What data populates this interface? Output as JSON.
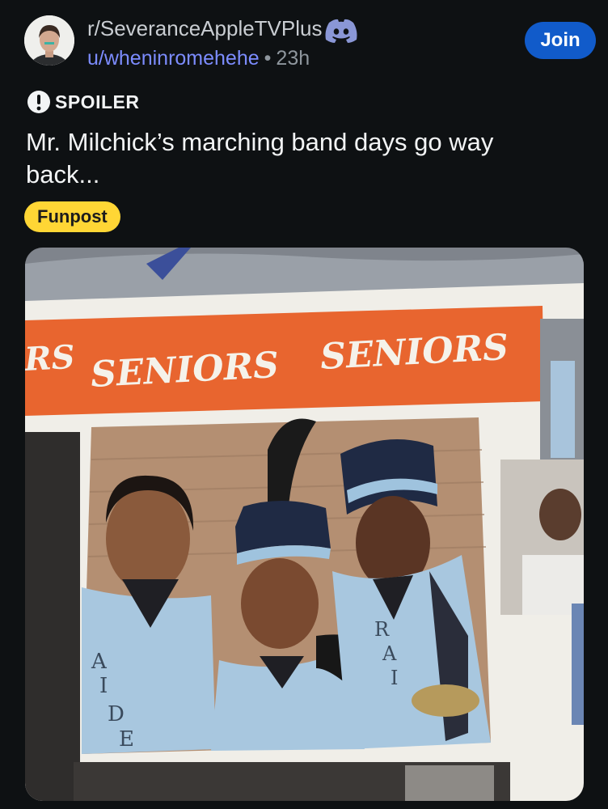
{
  "post": {
    "subreddit": "r/SeveranceAppleTVPlus",
    "username": "u/wheninromehehe",
    "separator": "•",
    "time_ago": "23h",
    "join_label": "Join",
    "spoiler_label": "SPOILER",
    "title": "Mr. Milchick’s marching band days go way back...",
    "flair": "Funpost"
  },
  "image": {
    "banner_words": [
      "RS",
      "SENIORS",
      "SENIORS"
    ],
    "jacket_letters_left": [
      "A",
      "I",
      "D",
      "E"
    ],
    "jacket_letters_right": [
      "R",
      "A",
      "I"
    ]
  },
  "colors": {
    "background": "#0e1113",
    "join_button": "#115bca",
    "flair": "#ffd635",
    "username": "#7c8cff",
    "discord": "#8a97d6",
    "banner": "#e8652f",
    "uniform": "#9fc3de"
  },
  "icons": {
    "discord": "discord-icon",
    "spoiler": "alert-circle-icon"
  }
}
